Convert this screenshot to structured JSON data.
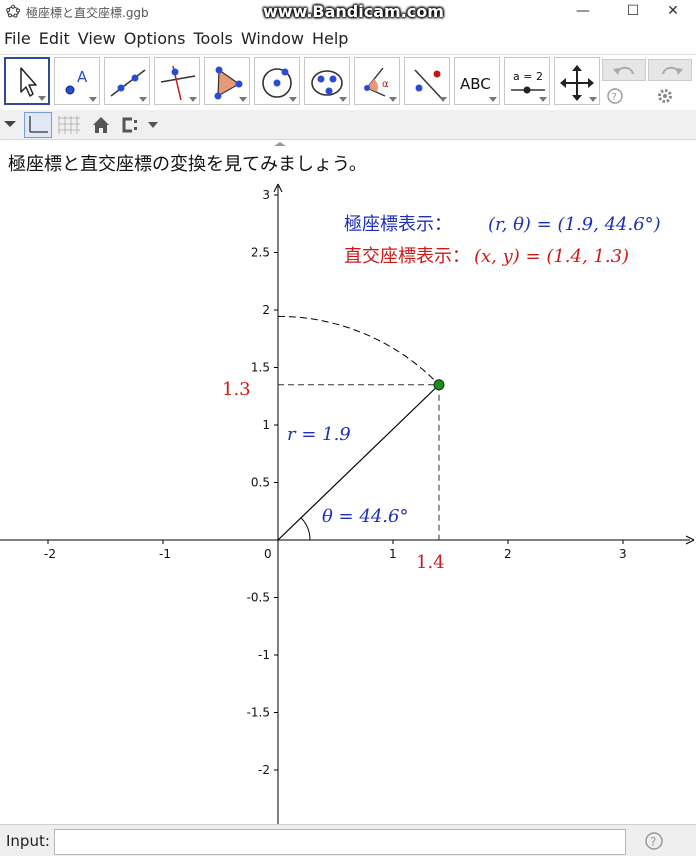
{
  "window": {
    "title": "極座標と直交座標.ggb",
    "watermark": "www.Bandicam.com",
    "controls": {
      "minimize": "—",
      "maximize": "☐",
      "close": "✕"
    }
  },
  "menu": [
    "File",
    "Edit",
    "View",
    "Options",
    "Tools",
    "Window",
    "Help"
  ],
  "toolbar": {
    "tools": [
      {
        "name": "move-tool",
        "icon": "arrow-cursor-icon"
      },
      {
        "name": "point-tool",
        "icon": "point-icon",
        "label": "A"
      },
      {
        "name": "line-tool",
        "icon": "line-through-points-icon"
      },
      {
        "name": "perpendicular-line-tool",
        "icon": "perpendicular-line-icon"
      },
      {
        "name": "polygon-tool",
        "icon": "polygon-icon"
      },
      {
        "name": "circle-tool",
        "icon": "circle-center-point-icon"
      },
      {
        "name": "ellipse-tool",
        "icon": "ellipse-icon"
      },
      {
        "name": "angle-tool",
        "icon": "angle-icon",
        "label": "α"
      },
      {
        "name": "reflect-tool",
        "icon": "reflect-about-line-icon"
      },
      {
        "name": "text-tool",
        "icon": "text-icon",
        "label": "ABC"
      },
      {
        "name": "slider-tool",
        "icon": "slider-icon",
        "label": "a = 2"
      },
      {
        "name": "move-graphics-tool",
        "icon": "move-graphics-view-icon"
      }
    ],
    "undo_icon": "undo-icon",
    "redo_icon": "redo-icon",
    "help_icon": "help-icon",
    "settings_icon": "gear-icon"
  },
  "stylebar": {
    "icons": [
      "dropdown-triangle-icon",
      "axes-toggle-icon",
      "grid-toggle-icon",
      "home-icon",
      "point-capture-icon"
    ]
  },
  "graphics": {
    "heading": "極座標と直交座標の変換を見てみましょう。",
    "polar_label": "極座標表示：",
    "polar_value": "(r, θ) = (1.9, 44.6°)",
    "rect_label": "直交座標表示：",
    "rect_value": "(x, y) = (1.4, 1.3)",
    "r_label": "r = 1.9",
    "theta_label": "θ = 44.6°",
    "x_marker": "1.4",
    "y_marker": "1.3",
    "colors": {
      "blue": "#1e2fb8",
      "red": "#d01818",
      "point": "#1e8c1e",
      "axis": "#000000"
    },
    "point": {
      "x": 1.4,
      "y": 1.35
    },
    "x_axis": {
      "ticks": [
        -2,
        -1,
        0,
        1,
        2,
        3
      ],
      "labels": [
        "-2",
        "-1",
        "0",
        "1",
        "2",
        "3"
      ]
    },
    "y_axis": {
      "ticks": [
        -2,
        -1.5,
        -1,
        -0.5,
        0.5,
        1,
        1.5,
        2,
        2.5,
        3
      ],
      "labels": [
        "-2",
        "-1.5",
        "-1",
        "-0.5",
        "0.5",
        "1",
        "1.5",
        "2",
        "2.5",
        "3"
      ]
    }
  },
  "input_bar": {
    "label": "Input:",
    "value": "",
    "help_icon": "help-icon"
  }
}
